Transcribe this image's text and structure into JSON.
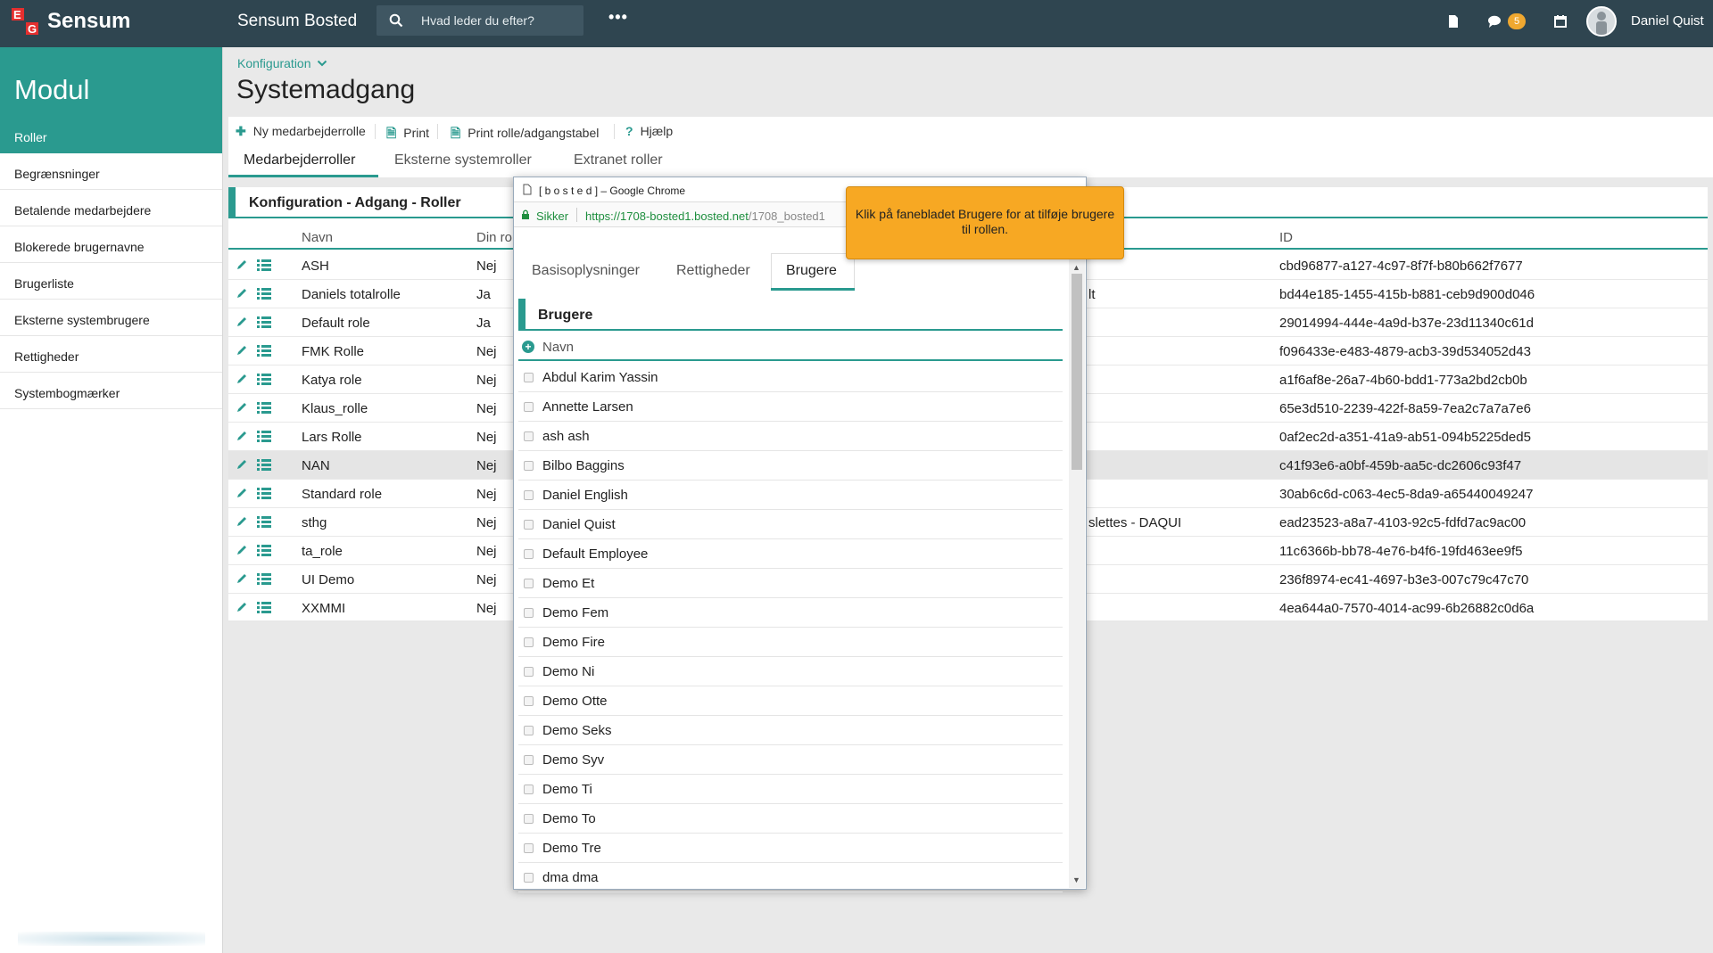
{
  "topbar": {
    "brand": "Sensum",
    "app_title": "Sensum Bosted",
    "search_placeholder": "Hvad leder du efter?",
    "more": "•••",
    "messages_count": "5",
    "user_name": "Daniel Quist"
  },
  "sidebar": {
    "title": "Modul",
    "items": [
      {
        "label": "Roller"
      },
      {
        "label": "Begrænsninger"
      },
      {
        "label": "Betalende medarbejdere"
      },
      {
        "label": "Blokerede brugernavne"
      },
      {
        "label": "Brugerliste"
      },
      {
        "label": "Eksterne systembrugere"
      },
      {
        "label": "Rettigheder"
      },
      {
        "label": "Systembogmærker"
      }
    ]
  },
  "page": {
    "breadcrumb": "Konfiguration",
    "title": "Systemadgang"
  },
  "toolbar": {
    "new_role": "Ny medarbejderrolle",
    "print": "Print",
    "print_table": "Print rolle/adgangstabel",
    "help": "Hjælp"
  },
  "tabs": [
    "Medarbejderroller",
    "Eksterne systemroller",
    "Extranet roller"
  ],
  "panel": {
    "title": "Konfiguration - Adgang - Roller",
    "columns": {
      "name": "Navn",
      "din": "Din ro",
      "id": "ID"
    },
    "rows": [
      {
        "name": "ASH",
        "din": "Nej",
        "desc": "",
        "id": "cbd96877-a127-4c97-8f7f-b80b662f7677"
      },
      {
        "name": "Daniels totalrolle",
        "din": "Ja",
        "desc": "lt",
        "id": "bd44e185-1455-415b-b881-ceb9d900d046"
      },
      {
        "name": "Default role",
        "din": "Ja",
        "desc": "",
        "id": "29014994-444e-4a9d-b37e-23d11340c61d"
      },
      {
        "name": "FMK Rolle",
        "din": "Nej",
        "desc": "",
        "id": "f096433e-e483-4879-acb3-39d534052d43"
      },
      {
        "name": "Katya role",
        "din": "Nej",
        "desc": "",
        "id": "a1f6af8e-26a7-4b60-bdd1-773a2bd2cb0b"
      },
      {
        "name": "Klaus_rolle",
        "din": "Nej",
        "desc": "",
        "id": "65e3d510-2239-422f-8a59-7ea2c7a7a7e6"
      },
      {
        "name": "Lars Rolle",
        "din": "Nej",
        "desc": "",
        "id": "0af2ec2d-a351-41a9-ab51-094b5225ded5"
      },
      {
        "name": "NAN",
        "din": "Nej",
        "desc": "",
        "id": "c41f93e6-a0bf-459b-aa5c-dc2606c93f47"
      },
      {
        "name": "Standard role",
        "din": "Nej",
        "desc": "",
        "id": "30ab6c6d-c063-4ec5-8da9-a65440049247"
      },
      {
        "name": "sthg",
        "din": "Nej",
        "desc": "slettes - DAQUI",
        "id": "ead23523-a8a7-4103-92c5-fdfd7ac9ac00"
      },
      {
        "name": "ta_role",
        "din": "Nej",
        "desc": "",
        "id": "11c6366b-bb78-4e76-b4f6-19fd463ee9f5"
      },
      {
        "name": "UI Demo",
        "din": "Nej",
        "desc": "",
        "id": "236f8974-ec41-4697-b3e3-007c79c47c70"
      },
      {
        "name": "XXMMI",
        "din": "Nej",
        "desc": "",
        "id": "4ea644a0-7570-4014-ac99-6b26882c0d6a"
      }
    ]
  },
  "popup": {
    "window_title": "[ b o s t e d ] – Google Chrome",
    "secure_label": "Sikker",
    "url_main": "https://1708-bosted1.bosted.net",
    "url_rest": "/1708_bosted1",
    "tabs": [
      "Basisoplysninger",
      "Rettigheder",
      "Brugere"
    ],
    "section_title": "Brugere",
    "column": "Navn",
    "users": [
      "Abdul Karim Yassin",
      "Annette Larsen",
      "ash ash",
      "Bilbo Baggins",
      "Daniel English",
      "Daniel Quist",
      "Default Employee",
      "Demo Et",
      "Demo Fem",
      "Demo Fire",
      "Demo Ni",
      "Demo Otte",
      "Demo Seks",
      "Demo Syv",
      "Demo Ti",
      "Demo To",
      "Demo Tre",
      "dma dma"
    ]
  },
  "tooltip": {
    "text": "Klik på fanebladet Brugere for at tilføje brugere til rollen."
  },
  "colors": {
    "accent": "#2a9a8f",
    "topbar": "#2f4550",
    "tooltip": "#f7a823"
  }
}
